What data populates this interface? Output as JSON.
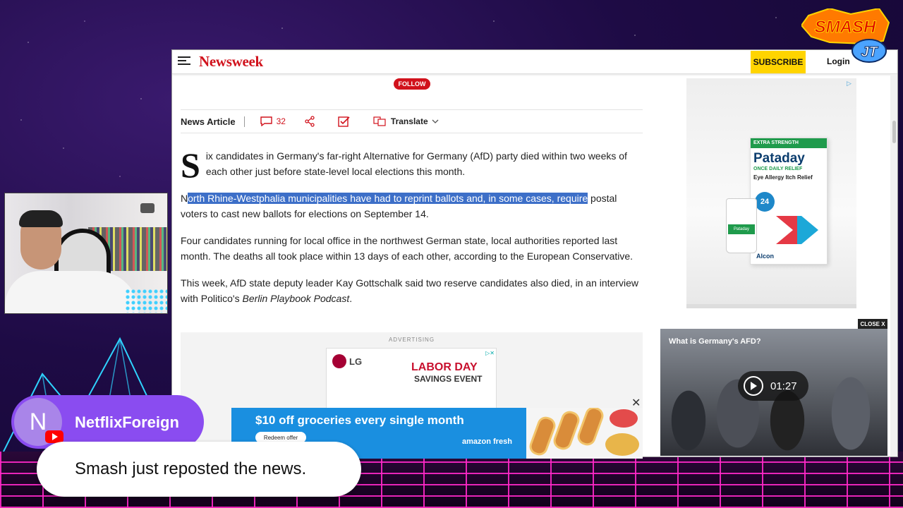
{
  "newsweek": {
    "logo": "Newsweek",
    "subscribe": "SUBSCRIBE",
    "login": "Login",
    "follow": "FOLLOW",
    "article_label": "News Article",
    "comment_count": "32",
    "translate": "Translate",
    "dropcap": "S",
    "p1_rest": "ix candidates in Germany's far-right Alternative for Germany (AfD) party died within two weeks of each other just before state-level local elections this month.",
    "p2_first": "N",
    "p2_highlight": "orth Rhine-Westphalia municipalities have had to reprint ballots and, in some cases, require",
    "p2_rest": " postal voters to cast new ballots for elections on September 14.",
    "p3": "Four candidates running for local office in the northwest German state, local authorities reported last month. The deaths all took place within 13 days of each other, according to the European Conservative.",
    "p4_start": "This week, AfD state deputy leader Kay Gottschalk said two reserve candidates also died, in an interview with Politico's ",
    "p4_italic": "Berlin Playbook Podcast",
    "p4_end": "."
  },
  "ad_inline": {
    "label": "ADVERTISING",
    "lg_logo": "LG",
    "headline": "LABOR DAY",
    "subline": "SAVINGS EVENT"
  },
  "side_ad": {
    "top_strip": "EXTRA STRENGTH",
    "brand": "Pataday",
    "sub": "ONCE DAILY RELIEF",
    "desc": "Eye Allergy Itch Relief",
    "badge": "24",
    "bottle": "Pataday",
    "maker": "Alcon"
  },
  "amazon_ad": {
    "headline": "$10 off groceries every single month",
    "button": "Redeem offer",
    "brand": "amazon fresh"
  },
  "video": {
    "title": "What is Germany's AFD?",
    "duration": "01:27",
    "close": "CLOSE X"
  },
  "chat": {
    "avatar_letter": "N",
    "username": "NetflixForeign",
    "message": "Smash just reposted the news."
  },
  "overlay": {
    "logo_top": "SMASH",
    "logo_bottom": "JT"
  },
  "colors": {
    "newsweek_red": "#d1121c",
    "subscribe_yellow": "#ffd400",
    "highlight_blue": "#3d6fc8",
    "chat_purple": "#8a4cf0"
  }
}
